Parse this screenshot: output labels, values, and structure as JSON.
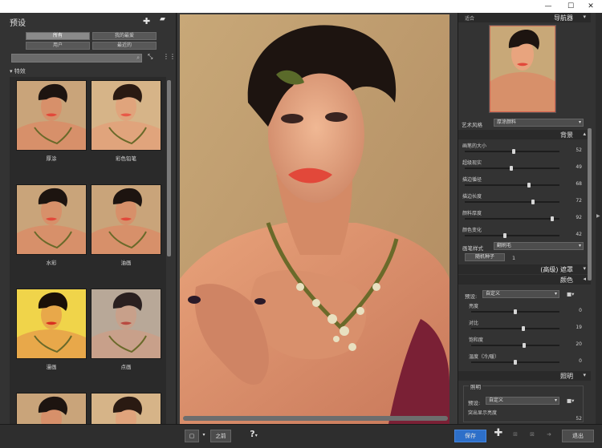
{
  "window": {
    "minimize_icon": "minimize-icon",
    "maximize_icon": "maximize-icon",
    "close_icon": "close-icon"
  },
  "presets": {
    "title": "预设",
    "filters": [
      {
        "label": "所有",
        "active": true
      },
      {
        "label": "我的最爱",
        "active": false
      },
      {
        "label": "用户",
        "active": false
      },
      {
        "label": "最近的",
        "active": false
      }
    ],
    "section": "特效",
    "thumbnails": [
      {
        "label": "厚涂",
        "style": "natural"
      },
      {
        "label": "彩色铅笔",
        "style": "pencil"
      },
      {
        "label": "水彩",
        "style": "natural"
      },
      {
        "label": "油画",
        "style": "natural"
      },
      {
        "label": "漫画",
        "style": "comic"
      },
      {
        "label": "点画",
        "style": "dots"
      },
      {
        "label": "",
        "style": "natural"
      },
      {
        "label": "",
        "style": "pencil"
      }
    ]
  },
  "navigator": {
    "zoom": "适合",
    "title": "导航器"
  },
  "art_style": {
    "label": "艺术风格",
    "value": "厚涂颜料"
  },
  "background": {
    "title": "背景",
    "sliders": [
      {
        "label": "画笔的大小",
        "value": 52
      },
      {
        "label": "超级现实",
        "value": 49
      },
      {
        "label": "描边循径",
        "value": 68
      },
      {
        "label": "描边长度",
        "value": 72
      },
      {
        "label": "颜料厚度",
        "value": 92
      },
      {
        "label": "颜色变化",
        "value": 42
      }
    ],
    "brush_style_label": "画笔样式",
    "brush_style_value": "翻刷毛",
    "random_seed_label": "随机种子",
    "random_seed_value": "1"
  },
  "mask": {
    "title": "(高级) 遮罩"
  },
  "color": {
    "title": "颜色",
    "preset_label": "预设:",
    "preset_value": "自定义",
    "sliders": [
      {
        "label": "亮度",
        "value": 0
      },
      {
        "label": "对比",
        "value": 19
      },
      {
        "label": "饱和度",
        "value": 20
      },
      {
        "label": "温度（冷/暖）",
        "value": 0
      }
    ]
  },
  "lighting": {
    "title": "照明",
    "group": "照明",
    "preset_label": "预设:",
    "preset_value": "自定义",
    "slider_label": "突出显示亮度",
    "slider_value": 52
  },
  "toolbar": {
    "before_label": "之前",
    "help_icon": "?",
    "save_label": "保存",
    "exit_label": "退出"
  },
  "colors": {
    "accent": "#2d6fc9",
    "panel": "#333333"
  }
}
